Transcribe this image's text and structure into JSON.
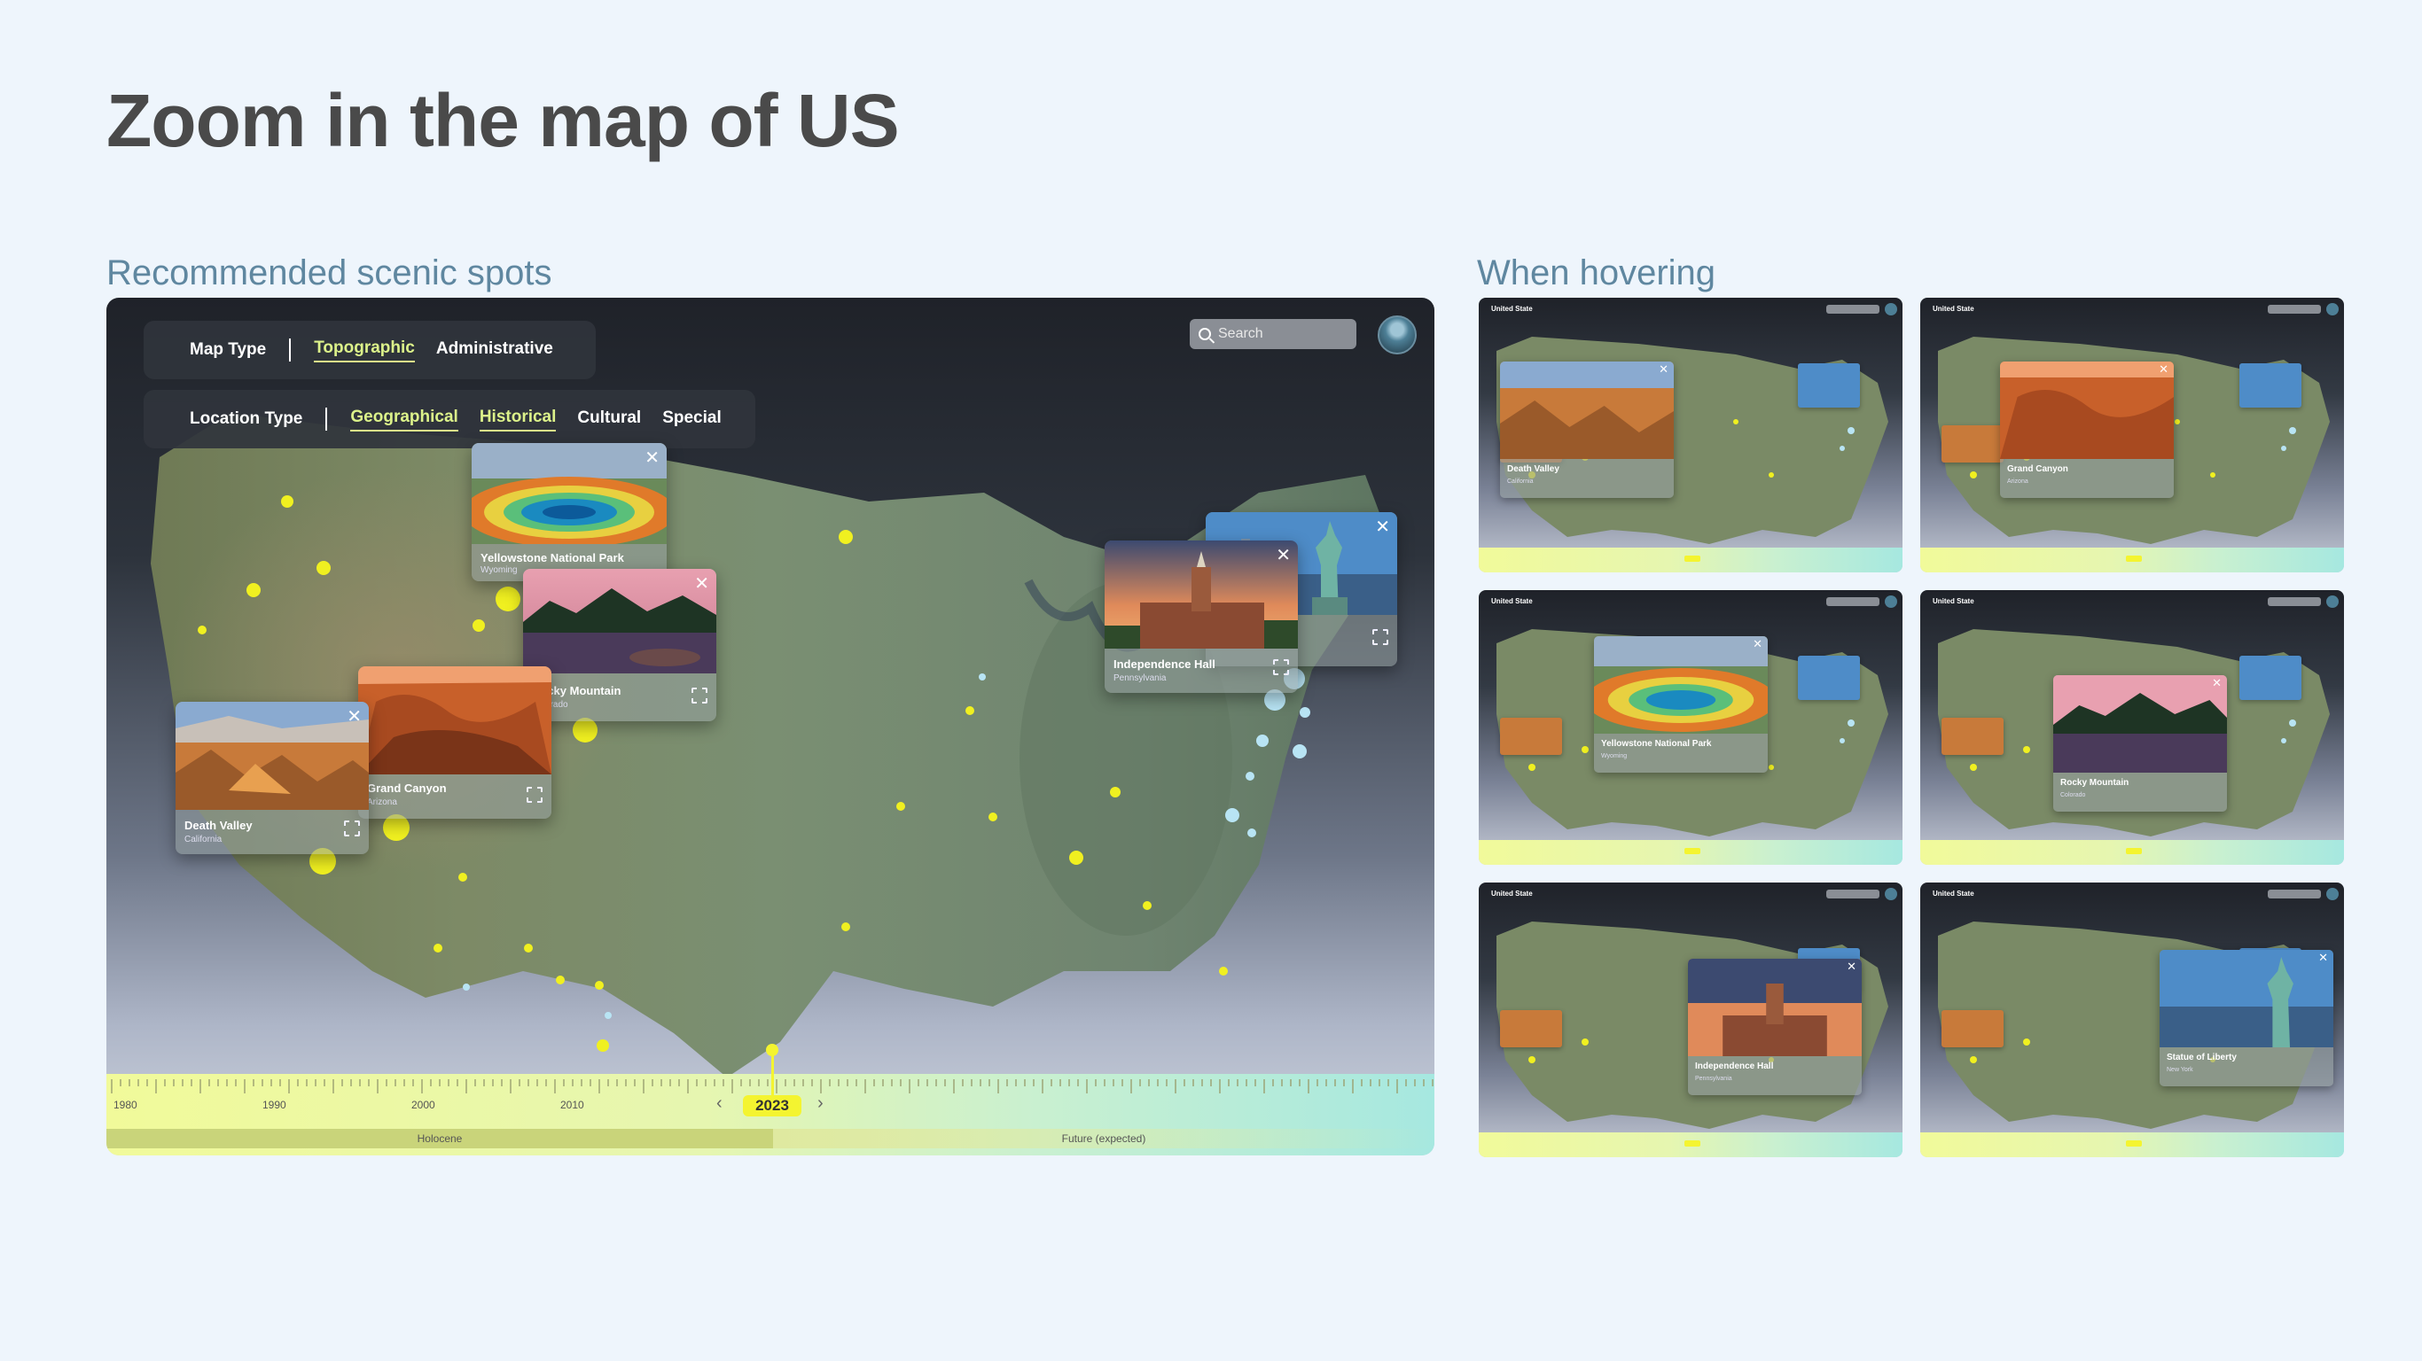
{
  "page": {
    "title": "Zoom in the map of US",
    "left_section": "Recommended scenic spots",
    "right_section": "When hovering"
  },
  "toolbar": {
    "map_type_label": "Map Type",
    "map_types": [
      "Topographic",
      "Administrative"
    ],
    "active_map_type": "Topographic",
    "location_type_label": "Location Type",
    "location_types": [
      "Geographical",
      "Historical",
      "Cultural",
      "Special"
    ],
    "active_location_types": [
      "Geographical",
      "Historical"
    ],
    "accent_color": "#dcf28a"
  },
  "search": {
    "placeholder": "Search"
  },
  "cards": [
    {
      "name": "Yellowstone National Park",
      "state": "Wyoming"
    },
    {
      "name": "Rocky Mountain",
      "state": "Colorado"
    },
    {
      "name": "Grand Canyon",
      "state": "Arizona"
    },
    {
      "name": "Death Valley",
      "state": "California"
    },
    {
      "name": "Independence Hall",
      "state": "Pennsylvania"
    },
    {
      "name": "Statue of Liberty",
      "state": "New York"
    }
  ],
  "timeline": {
    "years": [
      "1980",
      "1990",
      "2000",
      "2010"
    ],
    "current_year": "2023",
    "eras": [
      "Holocene",
      "Future (expected)"
    ],
    "prev_icon": "chevron-left-icon",
    "next_icon": "chevron-right-icon"
  },
  "hover_states": {
    "thumb_title": "United State",
    "highlighted": [
      "Death Valley",
      "Grand Canyon",
      "Yellowstone National Park",
      "Rocky Mountain",
      "Independence Hall",
      "Statue of Liberty"
    ],
    "states": [
      "California",
      "Arizona",
      "Wyoming",
      "Colorado",
      "Pennsylvania",
      "New York"
    ]
  },
  "colors": {
    "background": "#eef5fc",
    "title": "#4a4a4a",
    "section_label": "#5f87a0",
    "marker_yellow": "#f0f020",
    "marker_blue": "#b8e4f4"
  }
}
